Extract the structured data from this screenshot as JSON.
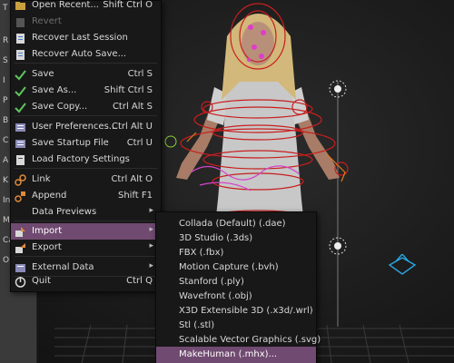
{
  "left_panel": {
    "tabs": [
      "T",
      "R",
      "S",
      "I",
      "P",
      "B",
      "C",
      "A",
      "K",
      "In",
      "M",
      "Ca",
      "Op"
    ],
    "rows": [
      "Tr",
      "Ro",
      "Sc",
      "Re",
      "Ca",
      "In",
      "Op",
      "Ph",
      "Cr",
      "Ke"
    ]
  },
  "file_menu": {
    "items": [
      {
        "label": "Open Recent...",
        "shortcut": "Shift Ctrl O",
        "icon": "open-recent-icon",
        "type": "submenu-arrow"
      },
      {
        "label": "Revert",
        "shortcut": "",
        "icon": "revert-icon",
        "disabled": true
      },
      {
        "label": "Recover Last Session",
        "shortcut": "",
        "icon": "recover-icon"
      },
      {
        "label": "Recover Auto Save...",
        "shortcut": "",
        "icon": "recover-auto-icon"
      },
      {
        "label": "Save",
        "shortcut": "Ctrl S",
        "icon": "checkmark-icon"
      },
      {
        "label": "Save As...",
        "shortcut": "Shift Ctrl S",
        "icon": "checkmark-icon"
      },
      {
        "label": "Save Copy...",
        "shortcut": "Ctrl Alt S",
        "icon": "checkmark-icon"
      },
      {
        "label": "User Preferences...",
        "shortcut": "Ctrl Alt U",
        "icon": "preferences-icon"
      },
      {
        "label": "Save Startup File",
        "shortcut": "Ctrl U",
        "icon": "save-startup-icon"
      },
      {
        "label": "Load Factory Settings",
        "shortcut": "",
        "icon": "factory-icon"
      },
      {
        "label": "Link",
        "shortcut": "Ctrl Alt O",
        "icon": "link-icon"
      },
      {
        "label": "Append",
        "shortcut": "Shift F1",
        "icon": "append-icon"
      },
      {
        "label": "Data Previews",
        "shortcut": "",
        "icon": "",
        "type": "submenu-arrow"
      },
      {
        "label": "Import",
        "shortcut": "",
        "icon": "import-icon",
        "type": "submenu-arrow",
        "active": true
      },
      {
        "label": "Export",
        "shortcut": "",
        "icon": "export-icon",
        "type": "submenu-arrow"
      },
      {
        "label": "External Data",
        "shortcut": "",
        "icon": "external-data-icon",
        "type": "submenu-arrow"
      },
      {
        "label": "Quit",
        "shortcut": "Ctrl Q",
        "icon": "quit-icon"
      }
    ]
  },
  "import_submenu": {
    "items": [
      {
        "label": "Collada (Default) (.dae)"
      },
      {
        "label": "3D Studio (.3ds)"
      },
      {
        "label": "FBX (.fbx)"
      },
      {
        "label": "Motion Capture (.bvh)"
      },
      {
        "label": "Stanford (.ply)"
      },
      {
        "label": "Wavefront (.obj)"
      },
      {
        "label": "X3D Extensible 3D (.x3d/.wrl)"
      },
      {
        "label": "Stl (.stl)"
      },
      {
        "label": "Scalable Vector Graphics (.svg)"
      },
      {
        "label": "MakeHuman (.mhx)...",
        "active": true
      }
    ]
  },
  "colors": {
    "accent": "#704a70",
    "menu_bg": "#181818",
    "rig": "#c81e1e"
  }
}
